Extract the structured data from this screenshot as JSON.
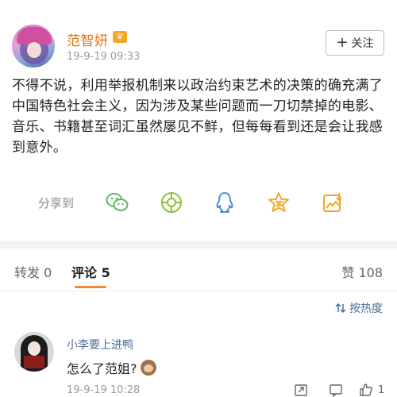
{
  "post": {
    "username": "范智妍",
    "vip_badge": "♛",
    "time": "19-9-19 09:33",
    "follow_label": "关注",
    "follow_plus": "+",
    "content": "不得不说，利用举报机制来以政治约束艺术的决策的确充满了中国特色社会主义，因为涉及某些问题而一刀切禁掉的电影、音乐、书籍甚至词汇虽然屡见不鲜，但每每看到还是会让我感到意外。"
  },
  "share": {
    "label": "分享到",
    "targets": [
      "wechat-icon",
      "moments-icon",
      "qq-icon",
      "qzone-icon",
      "save-image-icon"
    ],
    "accent": "#f5a623",
    "green": "#5cb85c",
    "blue": "#4a90d9"
  },
  "tabs": {
    "repost": {
      "label": "转发",
      "count": "0"
    },
    "comment": {
      "label": "评论",
      "count": "5"
    },
    "like": {
      "label": "赞",
      "count": "108"
    },
    "active_color": "#f08a24"
  },
  "sort": {
    "label": "按热度"
  },
  "comments": [
    {
      "user": "小李要上进鸭",
      "text": "怎么了范姐?",
      "time": "19-9-19 10:28",
      "likes": "1"
    }
  ]
}
